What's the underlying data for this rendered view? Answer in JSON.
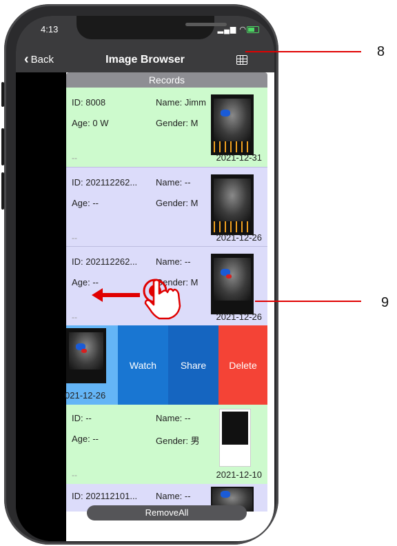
{
  "status": {
    "time": "4:13"
  },
  "nav": {
    "back_label": "Back",
    "title": "Image Browser"
  },
  "list": {
    "header": "Records",
    "records": [
      {
        "id": "ID: 8008",
        "name": "Name: Jimm",
        "age": "Age: 0 W",
        "gender": "Gender: M",
        "note": "--",
        "date": "2021-12-31"
      },
      {
        "id": "ID: 202112262...",
        "name": "Name: --",
        "age": "Age: --",
        "gender": "Gender: M",
        "note": "--",
        "date": "2021-12-26"
      },
      {
        "id": "ID: 202112262...",
        "name": "Name: --",
        "age": "Age: --",
        "gender": "Gender: M",
        "note": "--",
        "date": "2021-12-26"
      },
      {
        "id": "ID: --",
        "name": "Name: --",
        "age": "Age: --",
        "gender": "Gender: 男",
        "note": "--",
        "date": "2021-12-10"
      },
      {
        "id": "ID: 202112101...",
        "name": "Name: --"
      }
    ],
    "swiped_date": "021-12-26",
    "actions": {
      "watch": "Watch",
      "share": "Share",
      "delete": "Delete"
    }
  },
  "footer": {
    "remove_all": "RemoveAll"
  },
  "annotations": {
    "label_8": "8",
    "label_9": "9"
  },
  "colors": {
    "green_row": "#cdfacd",
    "lavender_row": "#dcdcfa",
    "watch_bg": "#1976d2",
    "share_bg": "#1565c0",
    "delete_bg": "#f44336",
    "callout": "#e00000"
  }
}
